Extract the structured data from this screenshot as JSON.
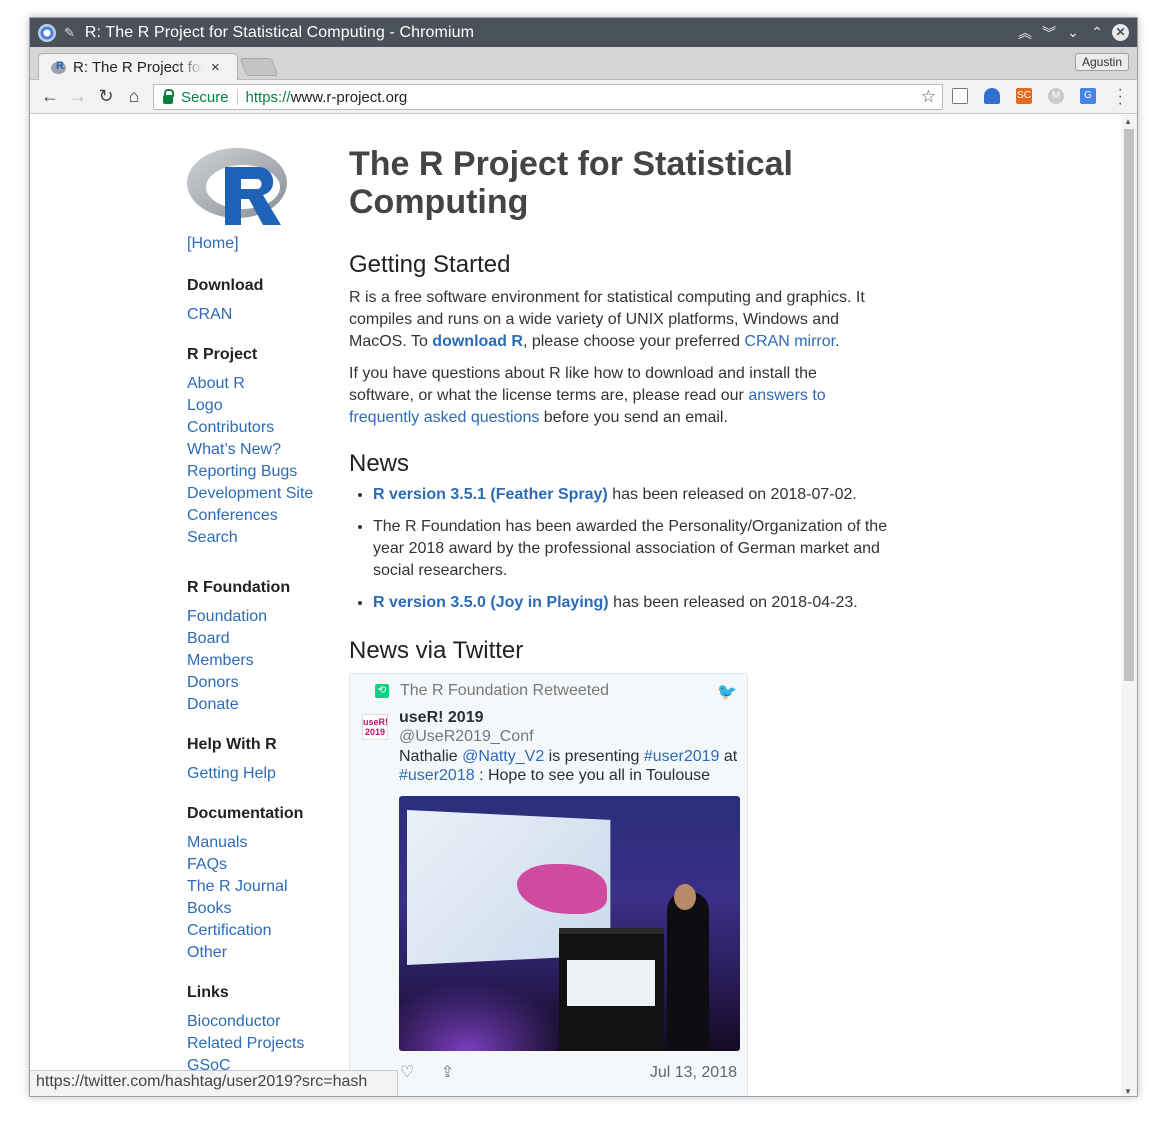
{
  "window": {
    "title": "R: The R Project for Statistical Computing - Chromium",
    "tab_title": "R: The R Project for Statistical Computing",
    "tab_close": "×",
    "profile": "Agustin"
  },
  "toolbar": {
    "security_label": "Secure",
    "url_scheme": "https://",
    "url_host": "www.r-project.org"
  },
  "sidebar": {
    "home": "[Home]",
    "sections": [
      {
        "heading": "Download",
        "items": [
          "CRAN"
        ]
      },
      {
        "heading": "R Project",
        "items": [
          "About R",
          "Logo",
          "Contributors",
          "What’s New?",
          "Reporting Bugs",
          "Development Site",
          "Conferences",
          "Search"
        ]
      },
      {
        "heading": "R Foundation",
        "items": [
          "Foundation",
          "Board",
          "Members",
          "Donors",
          "Donate"
        ]
      },
      {
        "heading": "Help With R",
        "items": [
          "Getting Help"
        ]
      },
      {
        "heading": "Documentation",
        "items": [
          "Manuals",
          "FAQs",
          "The R Journal",
          "Books",
          "Certification",
          "Other"
        ]
      },
      {
        "heading": "Links",
        "items": [
          "Bioconductor",
          "Related Projects",
          "GSoC"
        ]
      }
    ]
  },
  "main": {
    "title": "The R Project for Statistical Computing",
    "getting_started": {
      "heading": "Getting Started",
      "p1_a": "R is a free software environment for statistical computing and graphics. It compiles and runs on a wide variety of UNIX platforms, Windows and MacOS. To ",
      "p1_link1": "download R",
      "p1_b": ", please choose your preferred ",
      "p1_link2": "CRAN mirror",
      "p1_c": ".",
      "p2_a": "If you have questions about R like how to download and install the software, or what the license terms are, please read our ",
      "p2_link": "answers to frequently asked questions",
      "p2_b": " before you send an email."
    },
    "news": {
      "heading": "News",
      "items": [
        {
          "link": "R version 3.5.1 (Feather Spray)",
          "text": " has been released on 2018-07-02."
        },
        {
          "link": "",
          "text": "The R Foundation has been awarded the Personality/Organization of the year 2018 award by the professional association of German market and social researchers."
        },
        {
          "link": "R version 3.5.0 (Joy in Playing)",
          "text": " has been released on 2018-04-23."
        }
      ]
    },
    "twitter": {
      "heading": "News via Twitter",
      "retweeted_by": "The R Foundation Retweeted",
      "author_name": "useR! 2019",
      "author_handle": "@UseR2019_Conf",
      "avatar_text": "useR! 2019",
      "text_a": "Nathalie ",
      "mention": "@Natty_V2",
      "text_b": " is presenting ",
      "hashtag1": "#user2019",
      "text_c": " at ",
      "hashtag2": "#user2018",
      "text_d": " : Hope to see you all in Toulouse",
      "date": "Jul 13, 2018"
    }
  },
  "status_url": "https://twitter.com/hashtag/user2019?src=hash"
}
